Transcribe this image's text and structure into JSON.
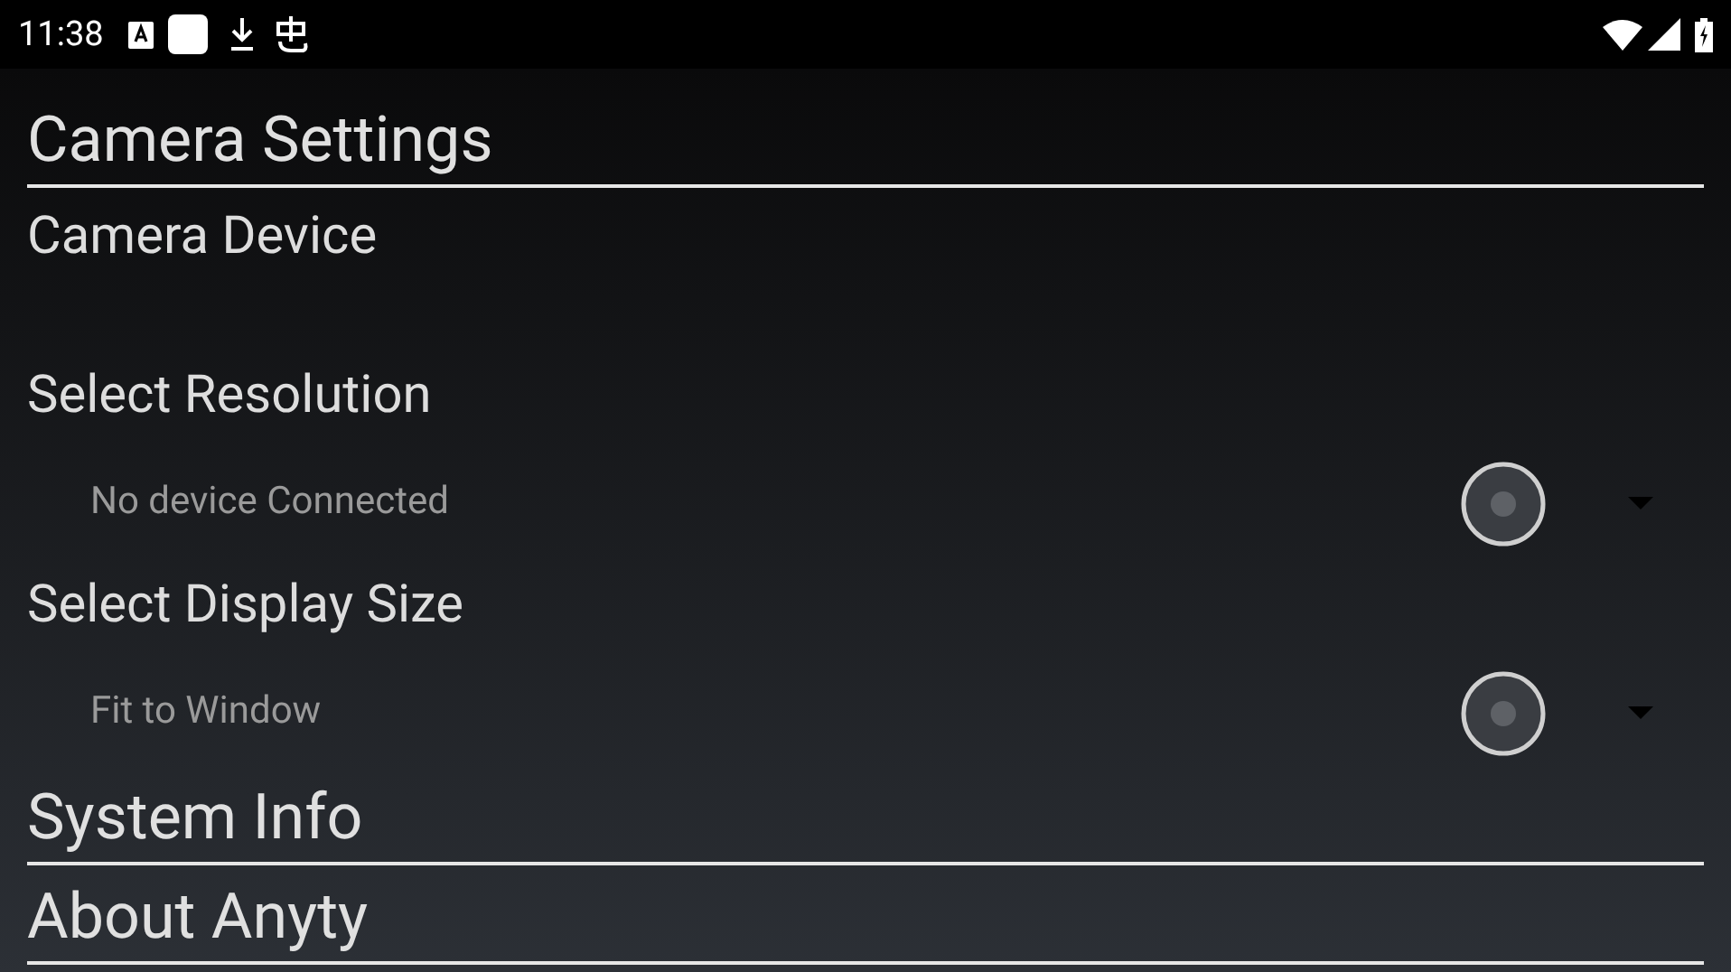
{
  "status_bar": {
    "time": "11:38"
  },
  "sections": [
    {
      "kind": "header",
      "title": "Camera Settings"
    },
    {
      "kind": "label",
      "title": "Camera Device"
    },
    {
      "kind": "label",
      "title": "Select Resolution"
    },
    {
      "kind": "spinner",
      "value": "No device Connected",
      "checked": false
    },
    {
      "kind": "label",
      "title": "Select Display Size"
    },
    {
      "kind": "spinner",
      "value": "Fit to Window",
      "checked": false
    },
    {
      "kind": "header",
      "title": "System Info"
    },
    {
      "kind": "header",
      "title": "About Anyty"
    }
  ]
}
